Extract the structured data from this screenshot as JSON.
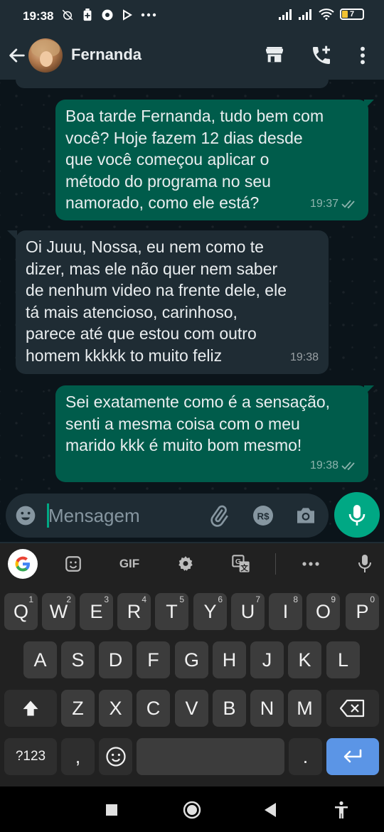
{
  "status_bar": {
    "time": "19:38",
    "battery_level": "7",
    "icons": [
      "alarm-off-icon",
      "battery-saver-icon",
      "chrome-icon",
      "play-icon",
      "more-dots-icon",
      "signal-icon",
      "signal-icon",
      "wifi-icon",
      "battery-icon"
    ]
  },
  "header": {
    "contact_name": "Fernanda",
    "icons": [
      "back-arrow-icon",
      "avatar",
      "store-icon",
      "add-call-icon",
      "more-vert-icon"
    ]
  },
  "messages": [
    {
      "direction": "outgoing",
      "text": "Boa tarde Fernanda, tudo bem com\nvocê? Hoje fazem 12 dias desde\nque você começou aplicar o\nmétodo do programa no seu\nnamorado, como ele está?",
      "time": "19:37",
      "status": "delivered-double-check"
    },
    {
      "direction": "incoming",
      "text": "Oi Juuu, Nossa, eu nem como te\ndizer, mas ele não quer nem saber\nde nenhum video na frente dele, ele\ntá mais atencioso, carinhoso,\nparece até que estou com outro\nhomem kkkkk to muito feliz",
      "time": "19:38"
    },
    {
      "direction": "outgoing",
      "text": "Sei exatamente como é a sensação,\nsenti a mesma coisa com o meu\nmarido kkk é muito bom mesmo!",
      "time": "19:38",
      "status": "delivered-double-check"
    }
  ],
  "composer": {
    "placeholder": "Mensagem",
    "icons": [
      "emoji-icon",
      "attach-icon",
      "payment-icon",
      "camera-icon",
      "mic-icon"
    ]
  },
  "keyboard": {
    "toolbar": {
      "gif_label": "GIF",
      "icons": [
        "google-icon",
        "sticker-icon",
        "gif-icon",
        "settings-icon",
        "translate-icon",
        "more-icon",
        "voice-icon"
      ]
    },
    "row1": [
      {
        "k": "Q",
        "n": "1"
      },
      {
        "k": "W",
        "n": "2"
      },
      {
        "k": "E",
        "n": "3"
      },
      {
        "k": "R",
        "n": "4"
      },
      {
        "k": "T",
        "n": "5"
      },
      {
        "k": "Y",
        "n": "6"
      },
      {
        "k": "U",
        "n": "7"
      },
      {
        "k": "I",
        "n": "8"
      },
      {
        "k": "O",
        "n": "9"
      },
      {
        "k": "P",
        "n": "0"
      }
    ],
    "row2": [
      "A",
      "S",
      "D",
      "F",
      "G",
      "H",
      "J",
      "K",
      "L"
    ],
    "row3": [
      "Z",
      "X",
      "C",
      "V",
      "B",
      "N",
      "M"
    ],
    "row4": {
      "symbols": "?123",
      "comma": ",",
      "period": "."
    }
  },
  "colors": {
    "outgoing_bubble": "#005c4b",
    "incoming_bubble": "#1f2c34",
    "accent": "#00a884",
    "enter_key": "#5b95e6"
  }
}
